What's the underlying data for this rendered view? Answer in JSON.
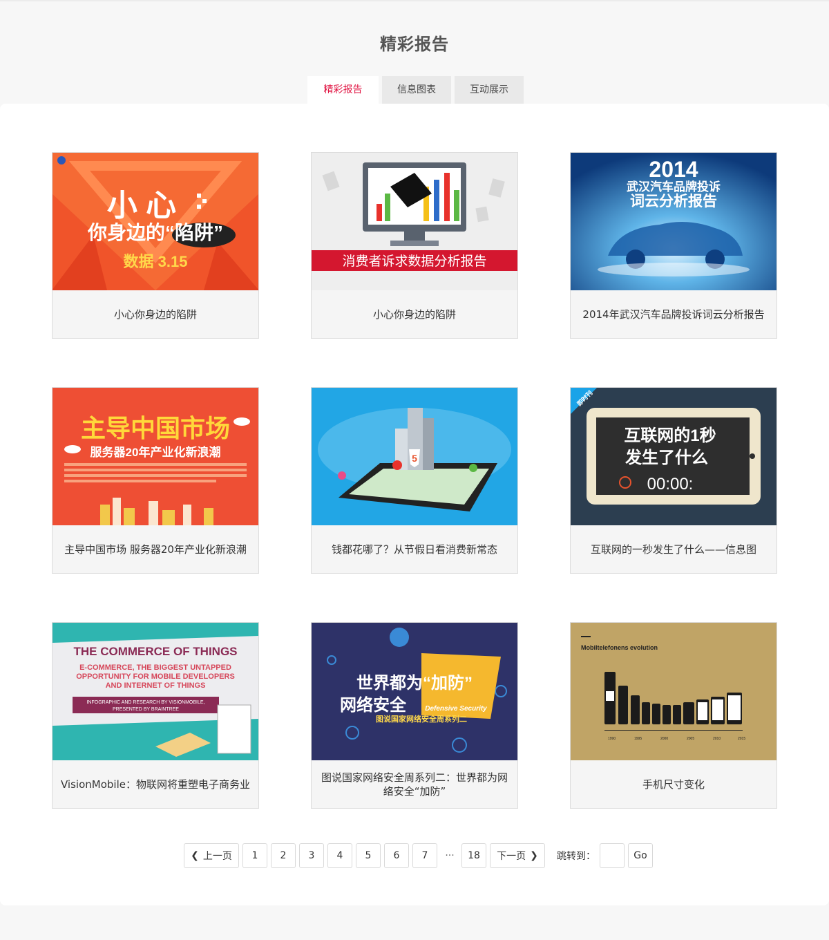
{
  "page": {
    "title": "精彩报告"
  },
  "tabs": [
    {
      "label": "精彩报告",
      "active": true
    },
    {
      "label": "信息图表",
      "active": false
    },
    {
      "label": "互动展示",
      "active": false
    }
  ],
  "cards": [
    {
      "caption": "小心你身边的陷阱",
      "thumb": {
        "line1": "小 心",
        "line2": "你身边的“陷阱”",
        "line3": "数据 3.15"
      }
    },
    {
      "caption": "小心你身边的陷阱",
      "thumb": {
        "banner": "消费者诉求数据分析报告"
      }
    },
    {
      "caption": "2014年武汉汽车品牌投诉词云分析报告",
      "thumb": {
        "line1": "2014",
        "line2": "武汉汽车品牌投诉",
        "line3": "词云分析报告"
      }
    },
    {
      "caption": "主导中国市场 服务器20年产业化新浪潮",
      "thumb": {
        "line1": "主导中国市场",
        "line2": "服务器20年产业化新浪潮"
      }
    },
    {
      "caption": "钱都花哪了？从节假日看消费新常态",
      "thumb": {
        "badge": "5"
      }
    },
    {
      "caption": "互联网的一秒发生了什么——信息图",
      "thumb": {
        "corner": "即时刊",
        "line1": "互联网的1秒",
        "line2": "发生了什么",
        "timer": "00:00:"
      }
    },
    {
      "caption": "VisionMobile：物联网将重塑电子商务业",
      "thumb": {
        "line1": "THE COMMERCE OF THINGS",
        "line2": "E-COMMERCE, THE BIGGEST UNTAPPED",
        "line3": "OPPORTUNITY FOR MOBILE DEVELOPERS",
        "line4": "AND INTERNET OF THINGS",
        "ribbon1": "INFOGRAPHIC AND RESEARCH BY VISIONMOBILE,",
        "ribbon2": "PRESENTED BY BRAINTREE"
      }
    },
    {
      "caption": "图说国家网络安全周系列二：世界都为网络安全“加防”",
      "thumb": {
        "line1": "世界都为“加防”",
        "line2": "网络安全",
        "line3": "Defensive Security",
        "line4": "图说国家网络安全周系列二"
      }
    },
    {
      "caption": "手机尺寸变化",
      "thumb": {
        "label": "Mobiltelefonens evolution",
        "years": [
          "1990",
          "1995",
          "2000",
          "2005",
          "2010",
          "2015"
        ]
      }
    }
  ],
  "pagination": {
    "prev": "上一页",
    "pages": [
      "1",
      "2",
      "3",
      "4",
      "5",
      "6",
      "7"
    ],
    "ellipsis": "···",
    "last": "18",
    "next": "下一页",
    "jump_label": "跳转到：",
    "go": "Go"
  },
  "colors": {
    "accent": "#e0103f",
    "tab_bg": "#e9e9e9",
    "card_bg": "#f5f5f5"
  }
}
